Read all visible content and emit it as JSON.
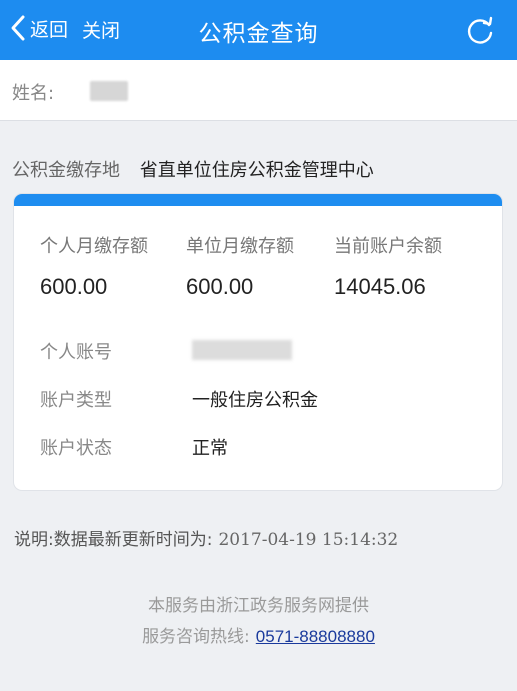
{
  "header": {
    "back_label": "返回",
    "close_label": "关闭",
    "title": "公积金查询",
    "back_icon": "chevron-left-icon",
    "refresh_icon": "refresh-icon",
    "bar_color": "#1d8cf0"
  },
  "profile": {
    "name_label": "姓名:"
  },
  "location": {
    "label": "公积金缴存地",
    "value": "省直单位住房公积金管理中心"
  },
  "summary": [
    {
      "label": "个人月缴存额",
      "value": "600.00"
    },
    {
      "label": "单位月缴存额",
      "value": "600.00"
    },
    {
      "label": "当前账户余额",
      "value": "14045.06"
    }
  ],
  "details": {
    "account_number_label": "个人账号",
    "account_type_label": "账户类型",
    "account_type_value": "一般住房公积金",
    "account_status_label": "账户状态",
    "account_status_value": "正常"
  },
  "note": {
    "label": "说明:数据最新更新时间为:",
    "timestamp": "2017-04-19 15:14:32"
  },
  "footer": {
    "provider": "本服务由浙江政务服务网提供",
    "hotline_label": "服务咨询热线:",
    "hotline_number": "0571-88808880"
  }
}
